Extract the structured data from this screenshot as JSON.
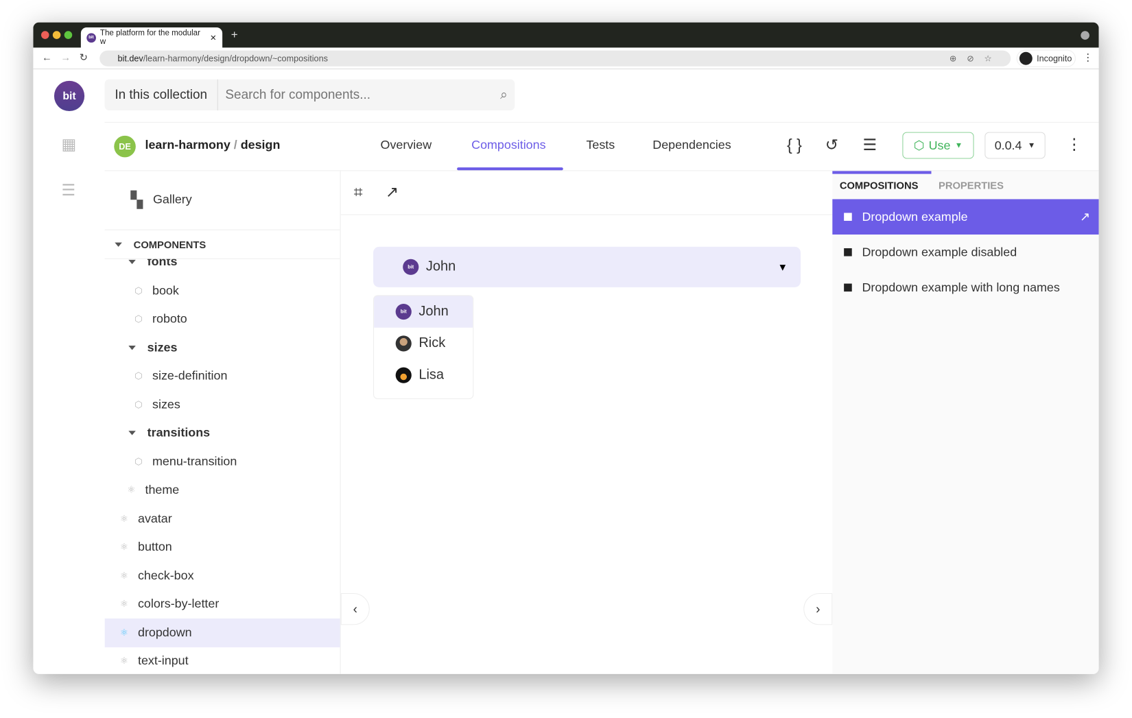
{
  "browser": {
    "tab_title": "The platform for the modular w",
    "url_host": "bit.dev",
    "url_path": "/learn-harmony/design/dropdown/~compositions",
    "profile": "Incognito"
  },
  "topbar": {
    "logo": "bit",
    "scope": "In this collection",
    "search_placeholder": "Search for components..."
  },
  "header": {
    "avatar": "DE",
    "scope": "learn-harmony",
    "sep": "/",
    "collection": "design",
    "tabs": [
      {
        "label": "Overview"
      },
      {
        "label": "Compositions"
      },
      {
        "label": "Tests"
      },
      {
        "label": "Dependencies"
      }
    ],
    "use_label": "Use",
    "version": "0.0.4"
  },
  "sidebar": {
    "gallery": "Gallery",
    "section": "COMPONENTS",
    "items": [
      {
        "label": "fonts",
        "type": "folder",
        "level": 2
      },
      {
        "label": "book",
        "type": "js",
        "level": 3
      },
      {
        "label": "roboto",
        "type": "js",
        "level": 3
      },
      {
        "label": "sizes",
        "type": "folder",
        "level": 2
      },
      {
        "label": "size-definition",
        "type": "js",
        "level": 3
      },
      {
        "label": "sizes",
        "type": "js",
        "level": 3
      },
      {
        "label": "transitions",
        "type": "folder",
        "level": 2
      },
      {
        "label": "menu-transition",
        "type": "js",
        "level": 3
      },
      {
        "label": "theme",
        "type": "react",
        "level": 2
      },
      {
        "label": "avatar",
        "type": "react",
        "level": 1
      },
      {
        "label": "button",
        "type": "react",
        "level": 1
      },
      {
        "label": "check-box",
        "type": "react",
        "level": 1
      },
      {
        "label": "colors-by-letter",
        "type": "react",
        "level": 1
      },
      {
        "label": "dropdown",
        "type": "react",
        "level": 1,
        "selected": true
      },
      {
        "label": "text-input",
        "type": "react",
        "level": 1
      }
    ]
  },
  "preview": {
    "selected": "John",
    "selected_avatar": "bit",
    "options": [
      {
        "label": "John",
        "avatar": "bit"
      },
      {
        "label": "Rick",
        "avatar": "rick"
      },
      {
        "label": "Lisa",
        "avatar": "lisa"
      }
    ]
  },
  "right_panel": {
    "tabs": [
      "COMPOSITIONS",
      "PROPERTIES"
    ],
    "items": [
      {
        "label": "Dropdown example",
        "selected": true
      },
      {
        "label": "Dropdown example disabled"
      },
      {
        "label": "Dropdown example with long names"
      }
    ]
  },
  "colors": {
    "accent": "#6c5ce7",
    "use_green": "#3fb45a",
    "selected_bg": "#ecebfb"
  }
}
